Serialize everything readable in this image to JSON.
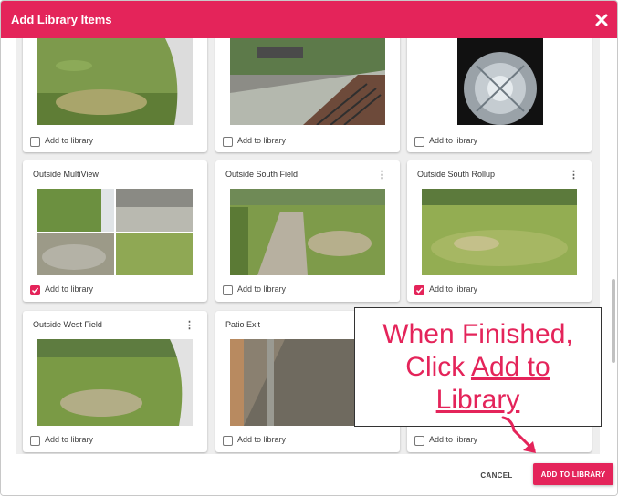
{
  "dialog": {
    "title": "Add Library Items",
    "close_icon": "close-icon",
    "accent_color": "#e4245a"
  },
  "cards": [
    {
      "title": "",
      "add_label": "Add to library",
      "checked": false,
      "has_menu": false
    },
    {
      "title": "",
      "add_label": "Add to library",
      "checked": false,
      "has_menu": false
    },
    {
      "title": "",
      "add_label": "Add to library",
      "checked": false,
      "has_menu": false
    },
    {
      "title": "Outside MultiView",
      "add_label": "Add to library",
      "checked": true,
      "has_menu": false
    },
    {
      "title": "Outside South Field",
      "add_label": "Add to library",
      "checked": false,
      "has_menu": true
    },
    {
      "title": "Outside South Rollup",
      "add_label": "Add to library",
      "checked": true,
      "has_menu": true
    },
    {
      "title": "Outside West Field",
      "add_label": "Add to library",
      "checked": false,
      "has_menu": true
    },
    {
      "title": "Patio Exit",
      "add_label": "Add to library",
      "checked": false,
      "has_menu": false
    },
    {
      "title": "",
      "add_label": "Add to library",
      "checked": false,
      "has_menu": false
    }
  ],
  "footer": {
    "cancel_label": "CANCEL",
    "add_label": "ADD TO LIBRARY"
  },
  "callout": {
    "line1": "When Finished,",
    "line2_prefix": "Click ",
    "line2_link": "Add to",
    "line3_link": "Library"
  }
}
